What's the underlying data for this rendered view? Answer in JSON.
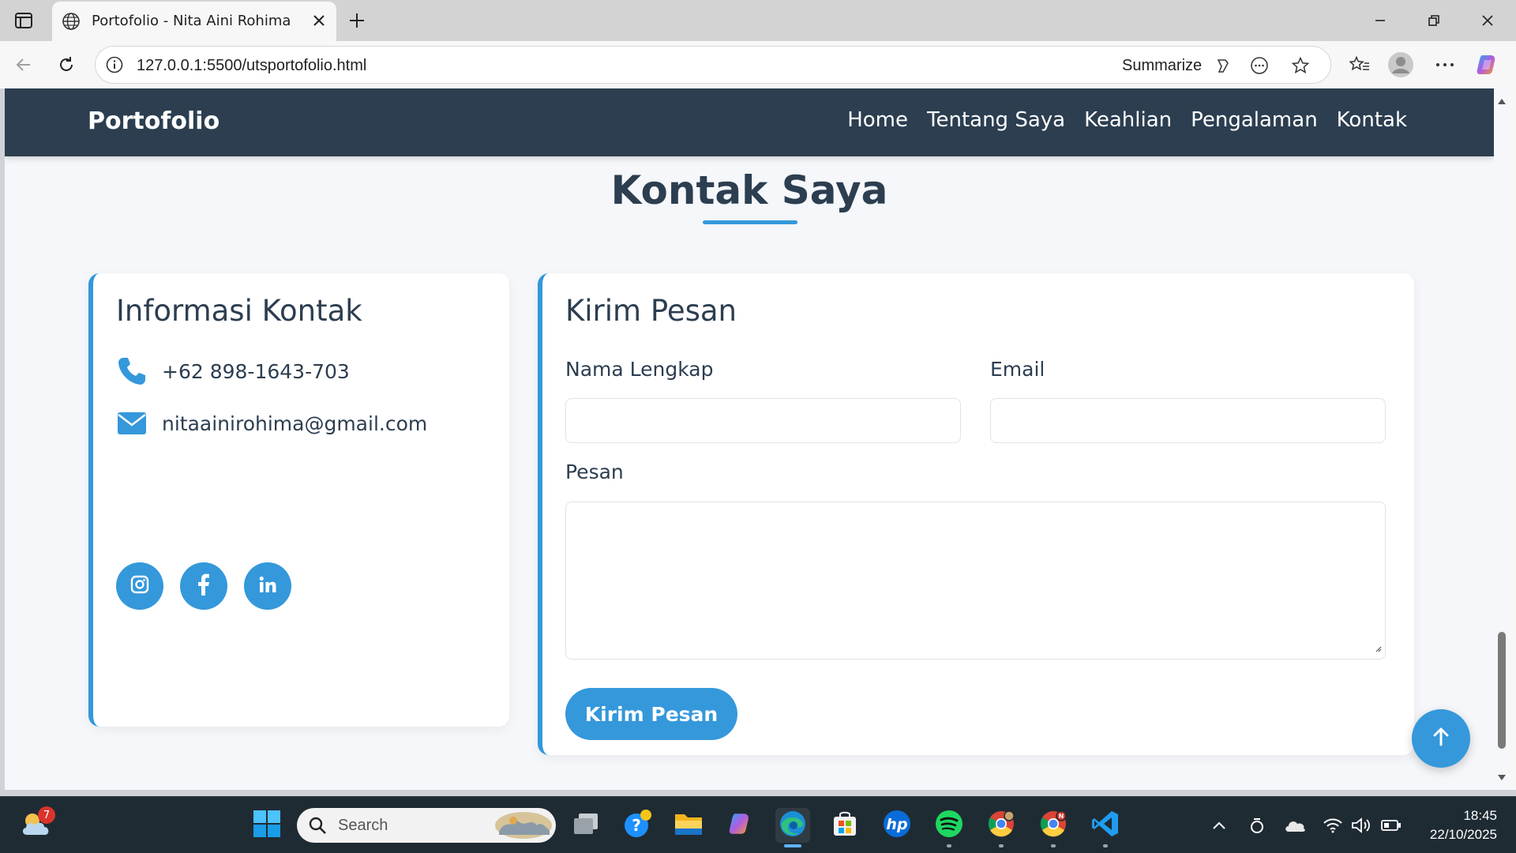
{
  "browser": {
    "tab_title": "Portofolio - Nita Aini Rohima",
    "url": "127.0.0.1:5500/utsportofolio.html",
    "summarize_label": "Summarize"
  },
  "site": {
    "brand": "Portofolio",
    "nav": [
      "Home",
      "Tentang Saya",
      "Keahlian",
      "Pengalaman",
      "Kontak"
    ],
    "section_title": "Kontak Saya",
    "accent_color": "#3498db",
    "nav_bg_color": "#2c3e50"
  },
  "contact_info": {
    "heading": "Informasi Kontak",
    "phone": "+62 898-1643-703",
    "email": "nitaainirohima@gmail.com",
    "socials": [
      "instagram-icon",
      "facebook-icon",
      "linkedin-icon"
    ]
  },
  "form": {
    "heading": "Kirim Pesan",
    "name_label": "Nama Lengkap",
    "email_label": "Email",
    "message_label": "Pesan",
    "name_value": "",
    "email_value": "",
    "message_value": "",
    "submit_label": "Kirim Pesan"
  },
  "taskbar": {
    "weather_badge": "7",
    "search_placeholder": "Search",
    "time": "18:45",
    "date": "22/10/2025"
  }
}
